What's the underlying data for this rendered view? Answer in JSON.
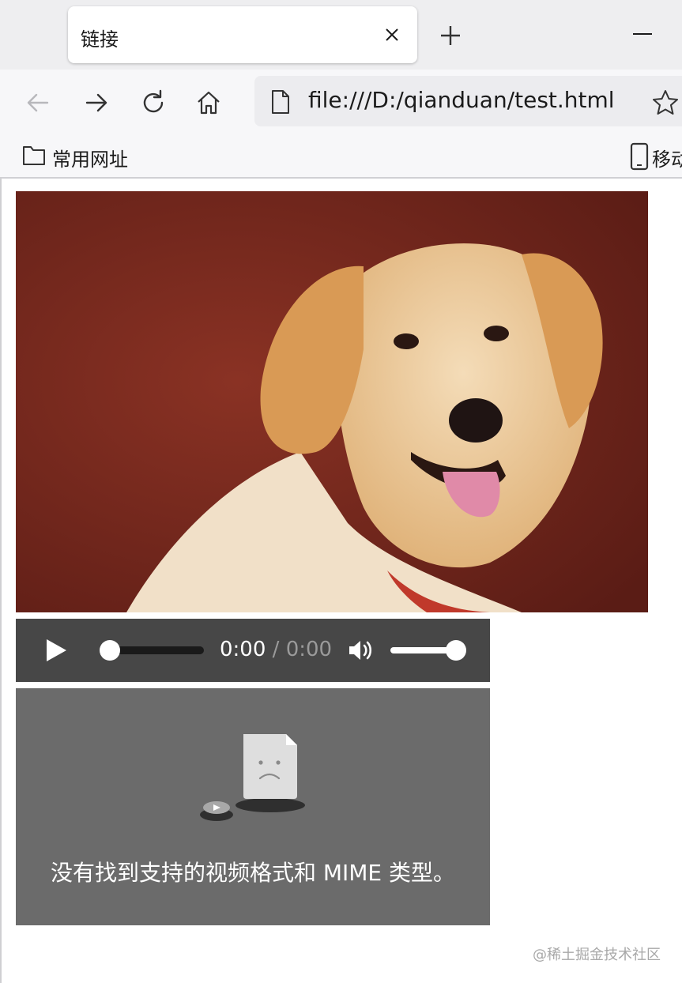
{
  "tab": {
    "title": "链接"
  },
  "toolbar": {
    "url": "file:///D:/qianduan/test.html"
  },
  "bookmarks": {
    "folder_label": "常用网址",
    "mobile_label": "移动"
  },
  "content": {
    "audio": {
      "current_time": "0:00",
      "separator": "/",
      "duration": "0:00",
      "progress": 0,
      "volume": 1.0
    },
    "video": {
      "error_message": "没有找到支持的视频格式和 MIME 类型。"
    },
    "watermark": "@稀土掘金技术社区"
  },
  "colors": {
    "tabstrip_bg": "#eeeef0",
    "toolbar_bg": "#f7f7f9",
    "audio_bg": "#474747",
    "video_bg": "#6b6b6b",
    "image_bg": "#7a2a20"
  },
  "icons": [
    "close-icon",
    "plus-icon",
    "minimize-icon",
    "back-arrow-icon",
    "forward-arrow-icon",
    "reload-icon",
    "home-icon",
    "page-icon",
    "star-icon",
    "folder-icon",
    "mobile-device-icon",
    "play-icon",
    "volume-icon",
    "broken-video-icon"
  ]
}
